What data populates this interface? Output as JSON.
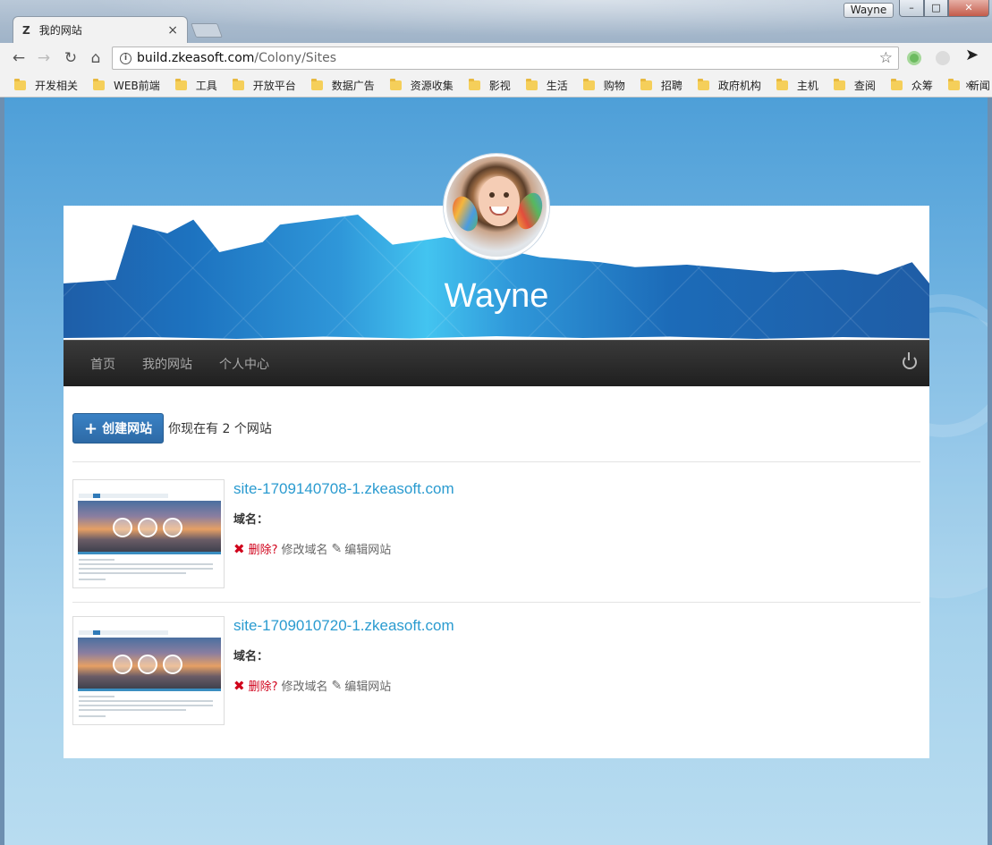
{
  "browser": {
    "tab_title": "我的网站",
    "tab_favicon": "Z",
    "tab_close": "×",
    "profile_name": "Wayne",
    "url_host": "build.zkeasoft.com",
    "url_path": "/Colony/Sites",
    "window_buttons": {
      "min": "–",
      "max": "□",
      "close": "✕"
    },
    "nav_icons": {
      "back": "←",
      "forward": "→",
      "reload": "↻",
      "home": "⌂",
      "star": "☆",
      "info": "i"
    },
    "bookmarks": [
      "开发相关",
      "WEB前端",
      "工具",
      "开放平台",
      "数据广告",
      "资源收集",
      "影视",
      "生活",
      "购物",
      "招聘",
      "政府机构",
      "主机",
      "查阅",
      "众筹",
      "新闻"
    ],
    "bookmarks_more": "»"
  },
  "profile": {
    "name": "Wayne"
  },
  "nav": {
    "items": [
      "首页",
      "我的网站",
      "个人中心"
    ]
  },
  "sites_header": {
    "create_label": "创建网站",
    "create_icon": "+",
    "count_text": "你现在有 2 个网站"
  },
  "sites": [
    {
      "name": "site-1709140708-1.zkeasoft.com",
      "domain_label": "域名：",
      "delete_label": "删除?",
      "edit_domain_label": "修改域名",
      "edit_site_label": "编辑网站"
    },
    {
      "name": "site-1709010720-1.zkeasoft.com",
      "domain_label": "域名：",
      "delete_label": "删除?",
      "edit_domain_label": "修改域名",
      "edit_site_label": "编辑网站"
    }
  ],
  "icons": {
    "delete": "✖",
    "edit": "✎"
  },
  "colors": {
    "accent": "#2a9bd0",
    "button": "#2d6aa6",
    "delete": "#d0021b",
    "navbar": "#2a2a2a"
  }
}
